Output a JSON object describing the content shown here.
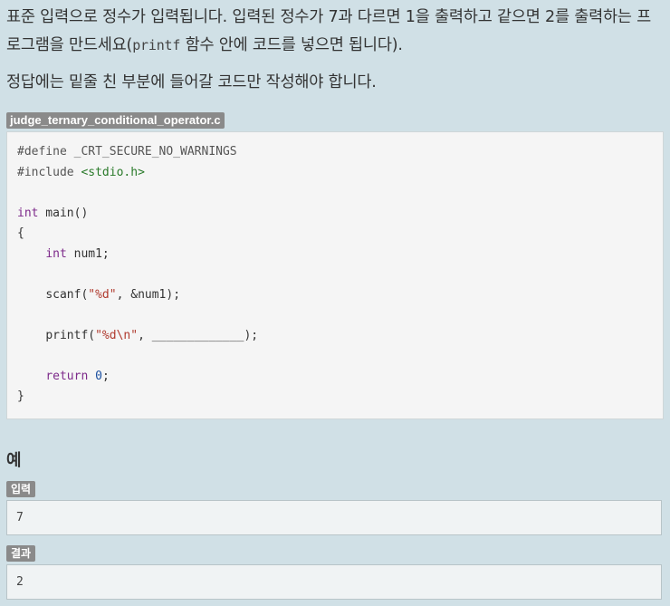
{
  "problem": {
    "description_pre": "표준 입력으로 정수가 입력됩니다. 입력된 정수가 7과 다르면 1을 출력하고 같으면 2를 출력하는 프로그램을 만드세요(",
    "description_code": "printf",
    "description_post": " 함수 안에 코드를 넣으면 됩니다).",
    "note": "정답에는 밑줄 친 부분에 들어갈 코드만 작성해야 합니다."
  },
  "code": {
    "filename": "judge_ternary_conditional_operator.c",
    "define": "#define _CRT_SECURE_NO_WARNINGS",
    "include_kw": "#include ",
    "include_hdr": "<stdio.h>",
    "int_kw": "int",
    "main_sig": " main()",
    "open_brace": "{",
    "decl_type": "int",
    "decl_var": " num1;",
    "scanf_fn": "scanf(",
    "scanf_fmt": "\"%d\"",
    "scanf_rest": ", &num1);",
    "printf_fn": "printf(",
    "printf_fmt": "\"%d\\n\"",
    "printf_rest": ", _____________);",
    "return_kw": "return",
    "return_val": "0",
    "return_end": ";",
    "close_brace": "}"
  },
  "example": {
    "title": "예",
    "input_label": "입력",
    "input_value": "7",
    "output_label": "결과",
    "output_value": "2"
  }
}
